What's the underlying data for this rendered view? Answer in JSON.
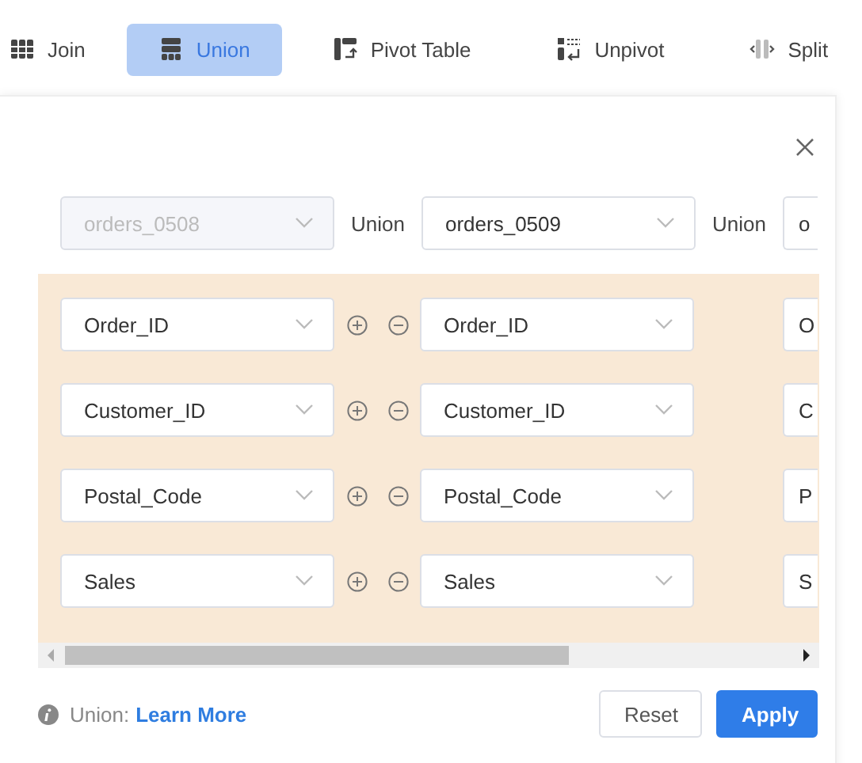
{
  "tabs": [
    {
      "label": "Join",
      "kind": "join",
      "selected": false
    },
    {
      "label": "Union",
      "kind": "union",
      "selected": true
    },
    {
      "label": "Pivot Table",
      "kind": "pivot",
      "selected": false
    },
    {
      "label": "Unpivot",
      "kind": "unpivot",
      "selected": false
    },
    {
      "label": "Split",
      "kind": "split",
      "selected": false
    }
  ],
  "tables": [
    {
      "value": "orders_0508",
      "disabled": true
    },
    {
      "connector": "Union",
      "value": "orders_0509",
      "disabled": false
    },
    {
      "connector": "Union",
      "value": "o",
      "disabled": false
    }
  ],
  "rows": [
    {
      "fields": [
        "Order_ID",
        "Order_ID",
        "O"
      ]
    },
    {
      "fields": [
        "Customer_ID",
        "Customer_ID",
        "C"
      ]
    },
    {
      "fields": [
        "Postal_Code",
        "Postal_Code",
        "P"
      ]
    },
    {
      "fields": [
        "Sales",
        "Sales",
        "S"
      ]
    }
  ],
  "footer": {
    "label": "Union:",
    "link": "Learn More"
  },
  "buttons": [
    {
      "label": "Reset",
      "kind": "secondary"
    },
    {
      "label": "Apply",
      "kind": "primary"
    }
  ]
}
